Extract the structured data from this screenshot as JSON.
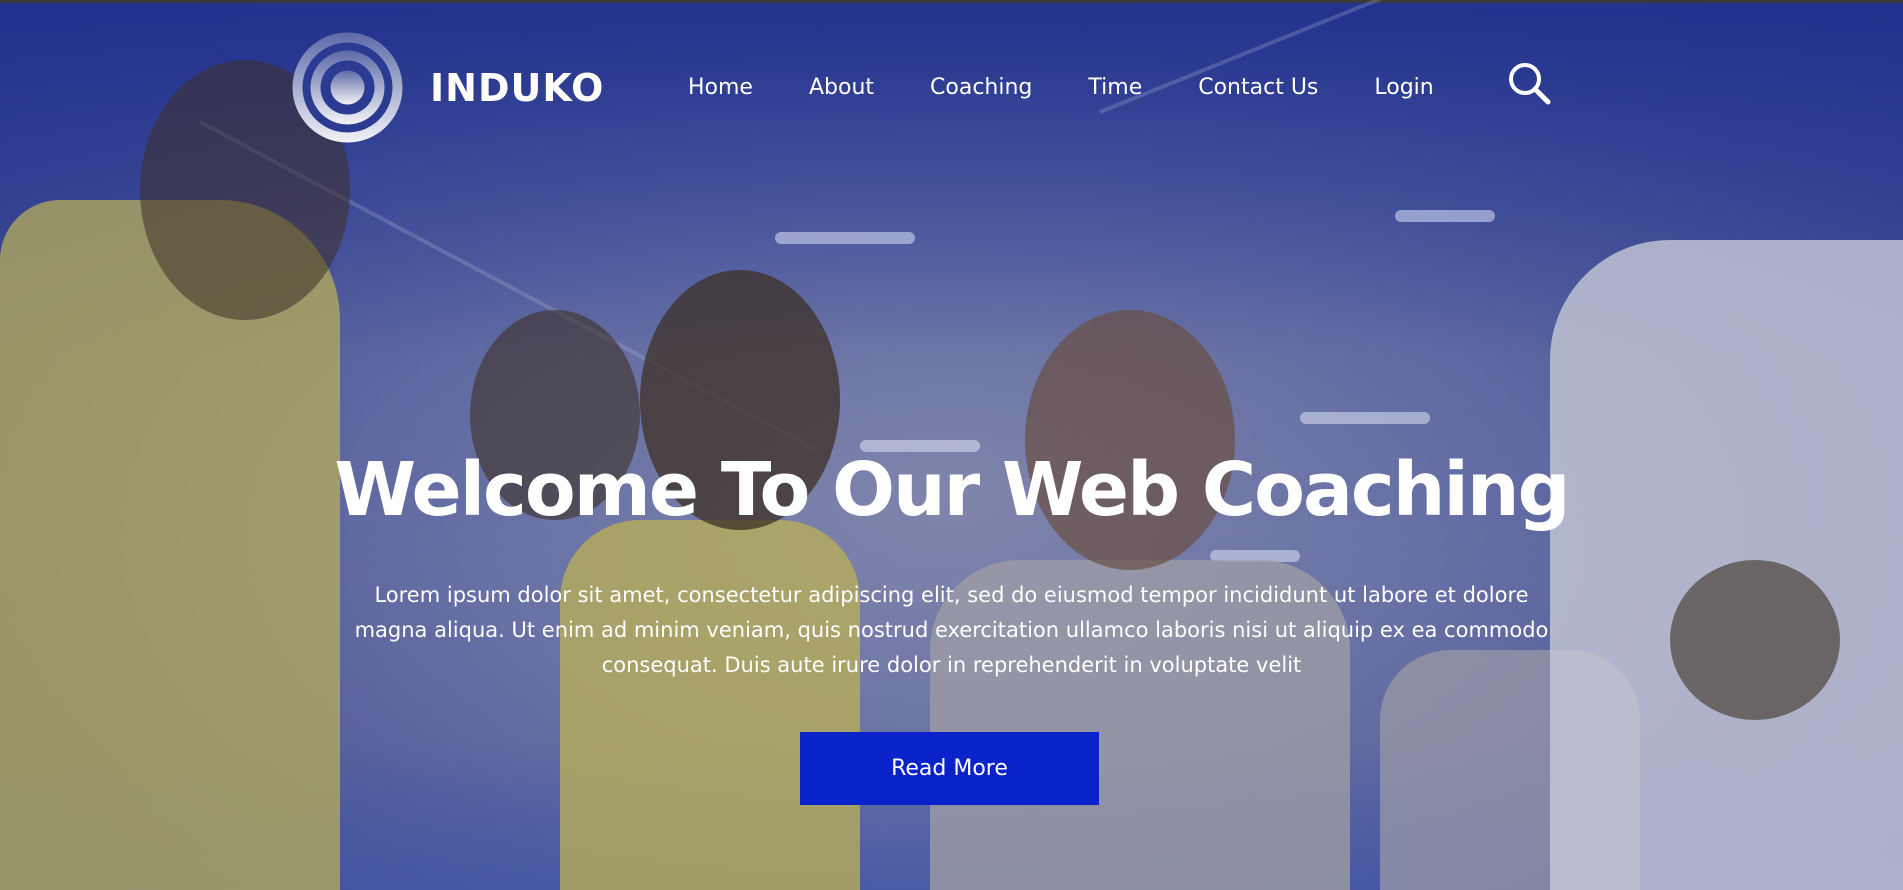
{
  "brand": {
    "name": "INDUKO",
    "logo_icon": "concentric-circles-logo-icon"
  },
  "nav": {
    "items": [
      {
        "label": "Home"
      },
      {
        "label": "About"
      },
      {
        "label": "Coaching"
      },
      {
        "label": "Time"
      },
      {
        "label": "Contact Us"
      },
      {
        "label": "Login"
      }
    ],
    "search_icon": "search-icon"
  },
  "hero": {
    "title": "Welcome To Our Web Coaching",
    "text": "Lorem ipsum dolor sit amet, consectetur adipiscing elit, sed do eiusmod tempor incididunt ut labore et dolore magna aliqua. Ut enim ad minim veniam, quis nostrud exercitation ullamco laboris nisi ut aliquip ex ea commodo consequat. Duis aute irure dolor in reprehenderit in voluptate velit",
    "button_label": "Read More"
  },
  "colors": {
    "overlay": "#20308e",
    "button": "#0a22c9",
    "text": "#ffffff"
  }
}
